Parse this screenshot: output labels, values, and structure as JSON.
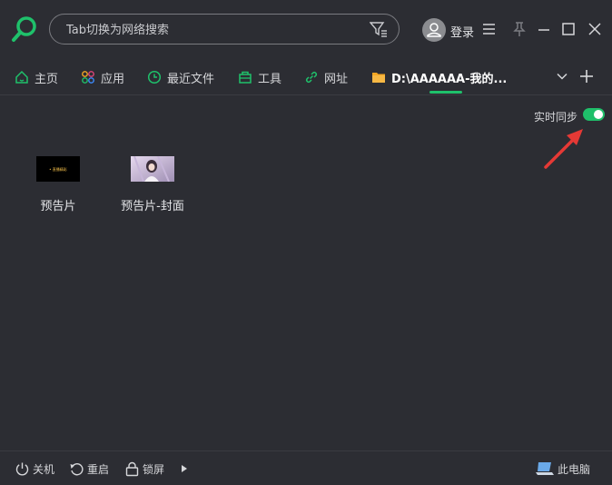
{
  "search": {
    "placeholder": "Tab切换为网络搜索"
  },
  "user": {
    "login_label": "登录"
  },
  "tabs": [
    {
      "label": "主页",
      "icon": "home-icon"
    },
    {
      "label": "应用",
      "icon": "apps-icon"
    },
    {
      "label": "最近文件",
      "icon": "clock-icon"
    },
    {
      "label": "工具",
      "icon": "toolbox-icon"
    },
    {
      "label": "网址",
      "icon": "link-icon"
    },
    {
      "label": "D:\\AAAAAA-我的...",
      "icon": "folder-icon",
      "active": true
    }
  ],
  "sync": {
    "label": "实时同步",
    "enabled": true
  },
  "files": [
    {
      "name": "预告片",
      "thumb_text": "• 直播精彩"
    },
    {
      "name": "预告片-封面"
    }
  ],
  "statusbar": {
    "shutdown": "关机",
    "restart": "重启",
    "lock": "锁屏",
    "computer": "此电脑"
  },
  "colors": {
    "accent": "#1fc16b",
    "background": "#2c2d33",
    "arrow": "#e53935"
  }
}
